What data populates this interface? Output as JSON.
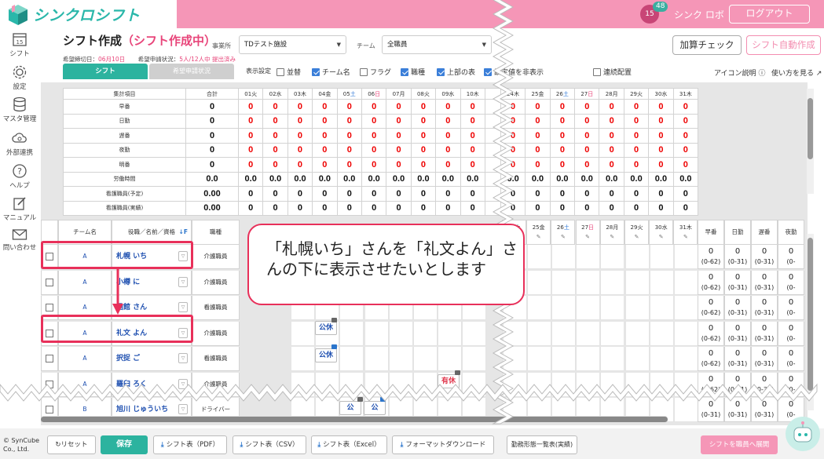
{
  "app": {
    "logo_text": "シンクロシフト",
    "calendar_day": "15",
    "notification_count": "48",
    "user_name": "シンク ロボ",
    "logout_label": "ログアウト"
  },
  "sidebar": [
    {
      "label": "シフト",
      "icon": "calendar-icon"
    },
    {
      "label": "設定",
      "icon": "gear-icon"
    },
    {
      "label": "マスタ管理",
      "icon": "database-icon"
    },
    {
      "label": "外部連携",
      "icon": "cloud-sync-icon"
    },
    {
      "label": "ヘルプ",
      "icon": "help-icon"
    },
    {
      "label": "マニュアル",
      "icon": "pencil-note-icon"
    },
    {
      "label": "問い合わせ",
      "icon": "mail-icon"
    }
  ],
  "header": {
    "title": "シフト作成",
    "status": "（シフト作成中）",
    "facility_label": "事業所",
    "facility_value": "TDテスト施設",
    "team_label": "チーム",
    "team_value": "全職員",
    "check_button": "加算チェック",
    "auto_button": "シフト自動作成",
    "deadline_label": "希望締切日：",
    "deadline_value": "06月10日",
    "request_label": "希望申請状況：",
    "request_value": "5人/12人中 提出済み"
  },
  "tabs": [
    {
      "label": "シフト"
    },
    {
      "label": "希望申請状況"
    }
  ],
  "display_options": {
    "label": "表示設定",
    "items": [
      {
        "label": "並替",
        "checked": false
      },
      {
        "label": "チーム名",
        "checked": true
      },
      {
        "label": "フラグ",
        "checked": false
      },
      {
        "label": "職種",
        "checked": true
      },
      {
        "label": "上部の表",
        "checked": true
      },
      {
        "label": "設定値を非表示",
        "checked": true
      },
      {
        "label": "連続配置",
        "checked": false
      }
    ],
    "icon_help": "アイコン説明",
    "howto": "使い方を見る"
  },
  "summary": {
    "header_label": "集計項目",
    "total_label": "合計",
    "days_left": [
      {
        "d": "01",
        "w": "火",
        "t": ""
      },
      {
        "d": "02",
        "w": "水",
        "t": ""
      },
      {
        "d": "03",
        "w": "木",
        "t": ""
      },
      {
        "d": "04",
        "w": "金",
        "t": ""
      },
      {
        "d": "05",
        "w": "土",
        "t": "sat"
      },
      {
        "d": "06",
        "w": "日",
        "t": "sun"
      },
      {
        "d": "07",
        "w": "月",
        "t": ""
      },
      {
        "d": "08",
        "w": "火",
        "t": ""
      },
      {
        "d": "09",
        "w": "水",
        "t": ""
      },
      {
        "d": "10",
        "w": "木",
        "t": ""
      }
    ],
    "days_right": [
      {
        "d": "24",
        "w": "木",
        "t": ""
      },
      {
        "d": "25",
        "w": "金",
        "t": ""
      },
      {
        "d": "26",
        "w": "土",
        "t": "sat"
      },
      {
        "d": "27",
        "w": "日",
        "t": "sun"
      },
      {
        "d": "28",
        "w": "月",
        "t": ""
      },
      {
        "d": "29",
        "w": "火",
        "t": ""
      },
      {
        "d": "30",
        "w": "水",
        "t": ""
      },
      {
        "d": "31",
        "w": "木",
        "t": ""
      }
    ],
    "rows": [
      {
        "label": "早番",
        "total": "0",
        "value": "0",
        "style": "red"
      },
      {
        "label": "日勤",
        "total": "0",
        "value": "0",
        "style": "red"
      },
      {
        "label": "遅番",
        "total": "0",
        "value": "0",
        "style": "red"
      },
      {
        "label": "夜勤",
        "total": "0",
        "value": "0",
        "style": "red"
      },
      {
        "label": "明番",
        "total": "0",
        "value": "0",
        "style": "red"
      },
      {
        "label": "労働時間",
        "total": "0.0",
        "value": "0.0",
        "style": "black"
      },
      {
        "label": "看護職員(予定)",
        "total": "0.00",
        "value": "0",
        "style": "black"
      },
      {
        "label": "看護職員(実績)",
        "total": "0.00",
        "value": "0",
        "style": "black"
      }
    ]
  },
  "staff_header": {
    "team": "チーム名",
    "name": "役職／名前／資格",
    "job": "職種",
    "sort_icon": "↓F"
  },
  "staff": [
    {
      "team": "A",
      "name": "札幌 いち",
      "job": "介護職員"
    },
    {
      "team": "A",
      "name": "小樽 に",
      "job": "介護職員"
    },
    {
      "team": "A",
      "name": "函館 さん",
      "job": "看護職員"
    },
    {
      "team": "A",
      "name": "礼文 よん",
      "job": "介護職員"
    },
    {
      "team": "A",
      "name": "択捉 ご",
      "job": "看護職員"
    },
    {
      "team": "A",
      "name": "羅臼 ろく",
      "job": "介護職員"
    },
    {
      "team": "B",
      "name": "旭川 じゅういち",
      "job": "ドライバー"
    }
  ],
  "shift_chips": {
    "holiday": "公休",
    "holiday_short": "公",
    "paid_leave": "有休"
  },
  "right_summary": {
    "heads": [
      "早番",
      "日勤",
      "遅番",
      "夜勤"
    ],
    "rows": [
      [
        "0",
        "(0-62)",
        "0",
        "(0-31)",
        "0",
        "(0-31)",
        "0",
        "(0-"
      ],
      [
        "0",
        "(0-62)",
        "0",
        "(0-31)",
        "0",
        "(0-31)",
        "0",
        "(0-"
      ],
      [
        "0",
        "(0-62)",
        "0",
        "(0-31)",
        "0",
        "(0-31)",
        "0",
        "(0-"
      ],
      [
        "0",
        "(0-62)",
        "0",
        "(0-31)",
        "0",
        "(0-31)",
        "0",
        "(0-"
      ],
      [
        "0",
        "(0-62)",
        "0",
        "(0-31)",
        "0",
        "(0-31)",
        "0",
        "(0-"
      ],
      [
        "0",
        "(0-62)",
        "0",
        "(0-31)",
        "0",
        "(0-31)",
        "0",
        "(0-"
      ],
      [
        "0",
        "(0-31)",
        "0",
        "(0-31)",
        "0",
        "(0-31)",
        "0",
        "(0-"
      ]
    ]
  },
  "callout": {
    "line1": "「札幌いち」さんを「礼文よん」さ",
    "line2": "んの下に表示させたいとします"
  },
  "footer": {
    "copyright_line1": "© SynCube",
    "copyright_line2": "Co., Ltd.",
    "reset": "リセット",
    "save": "保存",
    "pdf": "シフト表（PDF）",
    "csv": "シフト表（CSV）",
    "excel": "シフト表（Excel）",
    "format": "フォーマットダウンロード",
    "worklist": "勤務形態一覧表(実績)",
    "publish": "シフトを職員へ展開"
  },
  "colors": {
    "brand_pink": "#f596b7",
    "brand_teal": "#2cb39f",
    "highlight_red": "#e8305a"
  }
}
